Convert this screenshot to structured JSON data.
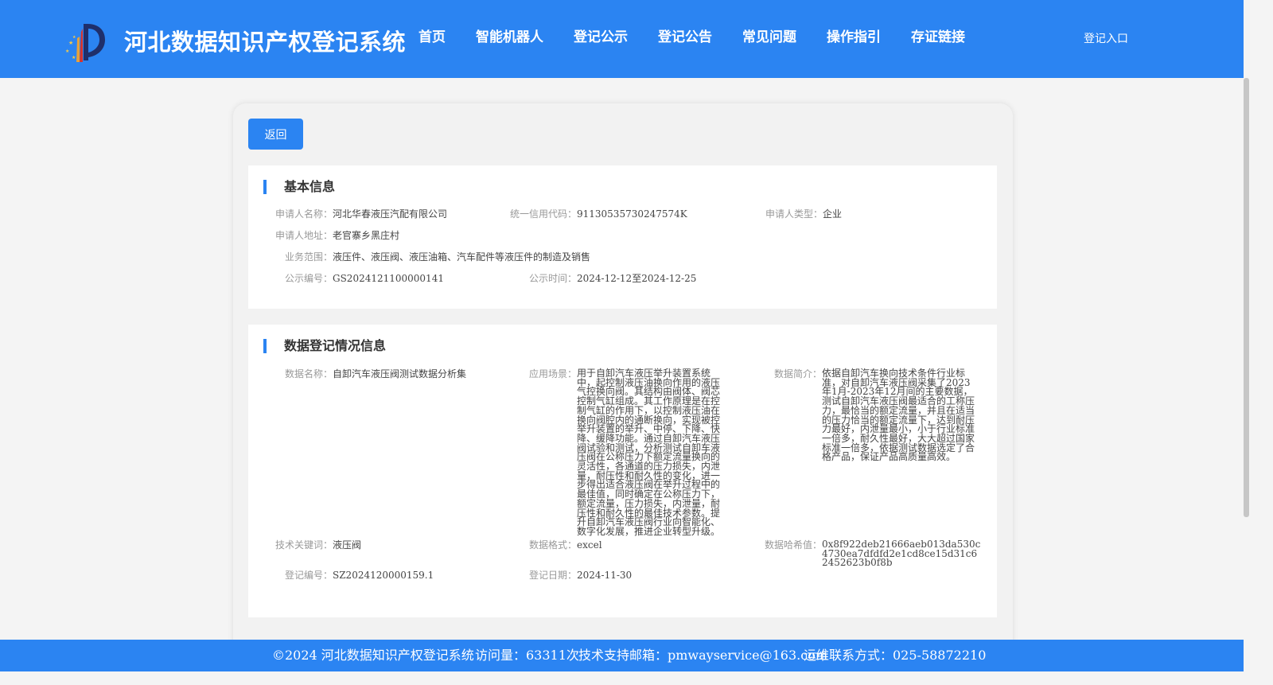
{
  "header": {
    "title": "河北数据知识产权登记系统",
    "nav": [
      "首页",
      "智能机器人",
      "登记公示",
      "登记公告",
      "常见问题",
      "操作指引",
      "存证链接"
    ],
    "login": "登记入口"
  },
  "back_button": "返回",
  "basic": {
    "title": "基本信息",
    "applicant_name_label": "申请人名称：",
    "applicant_name": "河北华春液压汽配有限公司",
    "credit_code_label": "统一信用代码：",
    "credit_code": "91130535730247574K",
    "applicant_type_label": "申请人类型：",
    "applicant_type": "企业",
    "address_label": "申请人地址：",
    "address": "老官寨乡黑庄村",
    "scope_label": "业务范围：",
    "scope": "液压件、液压阀、液压油箱、汽车配件等液压件的制造及销售",
    "notice_no_label": "公示编号：",
    "notice_no": "GS2024121100000141",
    "notice_time_label": "公示时间：",
    "notice_time": "2024-12-12至2024-12-25"
  },
  "registration": {
    "title": "数据登记情况信息",
    "data_name_label": "数据名称：",
    "data_name": "自卸汽车液压阀测试数据分析集",
    "scenario_label": "应用场景：",
    "scenario": "用于自卸汽车液压举升装置系统中，起控制液压油换向作用的液压气控换向阀。其结构由阀体、阀芯控制气缸组成。其工作原理是在控制气缸的作用下，以控制液压油在换向阀腔内的通断换向，实现被控举升装置的举升、中停、下降、快降、缓降功能。通过自卸汽车液压阀试验和测试，分析测试自卸车液压阀在公称压力下额定流量换向的灵活性，各通道的压力损失，内泄量，耐压性和耐久性的变化，进一步得出适合液压阀在举升过程中的最佳值，同时确定在公称压力下，额定流量，压力损失，内泄量，耐压性和耐久性的最佳技术参数。提升自卸汽车液压阀行业向智能化、数字化发展，推进企业转型升级。",
    "summary_label": "数据简介：",
    "summary": "依据自卸汽车换向技术条件行业标准，对自卸汽车液压阀采集了2023年1月-2023年12月间的主要数据，测试自卸汽车液压阀最适合的工称压力，最恰当的额定流量，并且在适当的压力恰当的额定流量下，达到耐压力最好，内泄量最小，小于行业标准一倍多，耐久性最好，大大超过国家标准一倍多，依据测试数据选定了合格产品，保证产品高质量高效。",
    "keywords_label": "技术关键词：",
    "keywords": "液压阀",
    "format_label": "数据格式：",
    "format": "excel",
    "hash_label": "数据哈希值：",
    "hash": "0x8f922deb21666aeb013da530c4730ea7dfdfd2e1cd8ce15d31c62452623b0f8b",
    "reg_no_label": "登记编号：",
    "reg_no": "SZ2024120000159.1",
    "reg_date_label": "登记日期：",
    "reg_date": "2024-11-30"
  },
  "footer": {
    "copyright": "©2024 河北数据知识产权登记系统",
    "visits": "访问量：63311次",
    "support": "技术支持邮箱：pmwayservice@163.com",
    "contact": "运维联系方式：025-58872210"
  },
  "colors": {
    "primary": "#2b84f2",
    "label": "#999999",
    "value": "#444444",
    "background": "#f4f4f4"
  }
}
